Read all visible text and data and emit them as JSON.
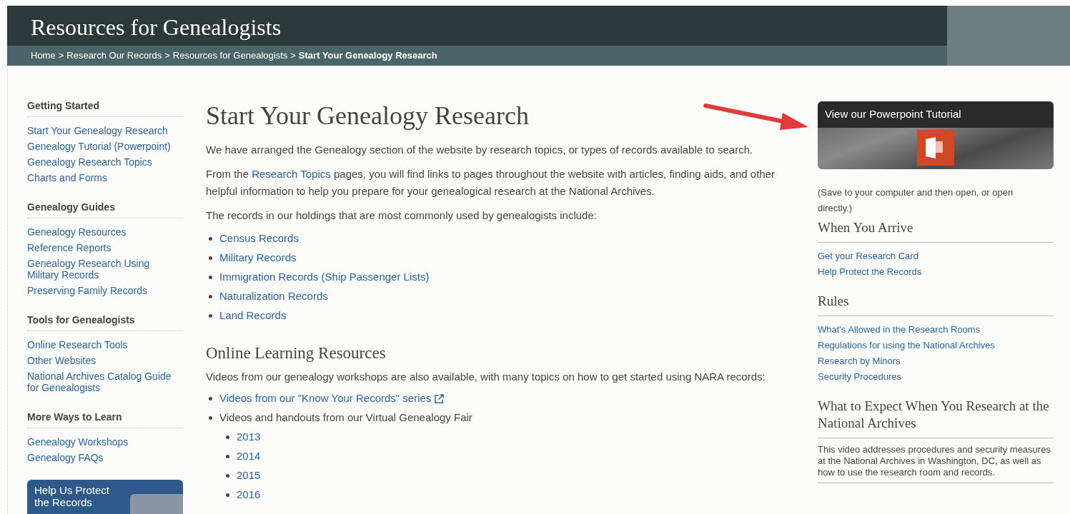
{
  "header": {
    "title": "Resources for Genealogists",
    "breadcrumb": [
      {
        "label": "Home",
        "current": false
      },
      {
        "label": "Research Our Records",
        "current": false
      },
      {
        "label": "Resources for Genealogists",
        "current": false
      },
      {
        "label": "Start Your Genealogy Research",
        "current": true
      }
    ],
    "separators": [
      ">",
      ">",
      ">"
    ]
  },
  "sidebar": {
    "sections": [
      {
        "heading": "Getting Started",
        "links": [
          "Start Your Genealogy Research",
          "Genealogy Tutorial (Powerpoint)",
          "Genealogy Research Topics",
          "Charts and Forms"
        ]
      },
      {
        "heading": "Genealogy Guides",
        "links": [
          "Genealogy Resources",
          "Reference Reports",
          "Genealogy Research Using Military Records",
          "Preserving Family Records"
        ]
      },
      {
        "heading": "Tools for Genealogists",
        "links": [
          "Online Research Tools",
          "Other Websites",
          "National Archives Catalog Guide for Genealogists"
        ]
      },
      {
        "heading": "More Ways to Learn",
        "links": [
          "Genealogy Workshops",
          "Genealogy FAQs"
        ]
      }
    ],
    "promo": {
      "title": "Help Us Protect the Records"
    }
  },
  "main": {
    "title": "Start Your Genealogy Research",
    "intro": "We have arranged the Genealogy section of the website by research topics, or types of records available to search.",
    "topics_paragraph": {
      "before": "From the ",
      "link": "Research Topics",
      "after": " pages, you will find links to pages throughout the website with articles, finding aids, and other helpful information to help you prepare for your genealogical research at the National Archives."
    },
    "records_intro": "The records in our holdings that are most commonly used by genealogists include:",
    "record_links": [
      "Census Records",
      "Military Records",
      "Immigration Records (Ship Passenger Lists)",
      "Naturalization Records",
      "Land Records"
    ],
    "learning": {
      "heading": "Online Learning Resources",
      "intro": "Videos from our genealogy workshops are also available, with many topics on how to get started using NARA records:",
      "items": [
        {
          "label": "Videos from our \"Know Your Records\" series",
          "kind": "link",
          "external": true
        },
        {
          "label": "Videos and handouts from our Virtual Genealogy Fair",
          "kind": "text",
          "children": [
            "2013",
            "2014",
            "2015",
            "2016"
          ]
        }
      ]
    }
  },
  "right": {
    "tutorial_card": {
      "title": "View our Powerpoint Tutorial"
    },
    "note": "(Save to your computer and then open, or open directly.)",
    "sections": [
      {
        "heading": "When You Arrive",
        "links": [
          "Get your Research Card",
          "Help Protect the Records"
        ]
      },
      {
        "heading": "Rules",
        "links": [
          "What's Allowed in the Research Rooms",
          "Regulations for using the National Archives",
          "Research by Minors",
          "Security Procedures"
        ]
      },
      {
        "heading": "What to Expect When You Research at the National Archives",
        "text": "This video addresses procedures and security measures at the National Archives in Washington, DC, as well as how to use the research room and records."
      }
    ]
  }
}
